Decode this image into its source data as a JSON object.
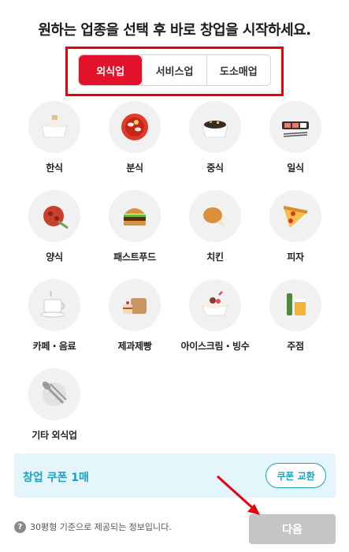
{
  "title": "원하는 업종을 선택 후 바로 창업을 시작하세요.",
  "tabs": [
    {
      "label": "외식업",
      "active": true
    },
    {
      "label": "서비스업",
      "active": false
    },
    {
      "label": "도소매업",
      "active": false
    }
  ],
  "categories": [
    {
      "label": "한식",
      "icon": "rice-bowl-icon"
    },
    {
      "label": "분식",
      "icon": "tteokbokki-icon"
    },
    {
      "label": "중식",
      "icon": "noodle-bowl-icon"
    },
    {
      "label": "일식",
      "icon": "sushi-icon"
    },
    {
      "label": "양식",
      "icon": "pasta-icon"
    },
    {
      "label": "패스트푸드",
      "icon": "burger-icon"
    },
    {
      "label": "치킨",
      "icon": "chicken-icon"
    },
    {
      "label": "피자",
      "icon": "pizza-icon"
    },
    {
      "label": "카페・음료",
      "icon": "coffee-cup-icon"
    },
    {
      "label": "제과제빵",
      "icon": "bread-icon"
    },
    {
      "label": "아이스크림・빙수",
      "icon": "bingsu-icon"
    },
    {
      "label": "주점",
      "icon": "beer-icon"
    },
    {
      "label": "기타 외식업",
      "icon": "utensils-icon"
    }
  ],
  "coupon": {
    "text": "창업 쿠폰 1매",
    "button_label": "쿠폰 교환"
  },
  "info": {
    "icon_glyph": "?",
    "text": "30평형 기준으로 제공되는 정보입니다."
  },
  "next_button": "다음",
  "colors": {
    "accent_red": "#e3122b",
    "highlight_red": "#e8000b",
    "coupon_blue": "#17a2c9",
    "coupon_bg": "#e4f6fb",
    "disabled_gray": "#c5c5c5"
  }
}
